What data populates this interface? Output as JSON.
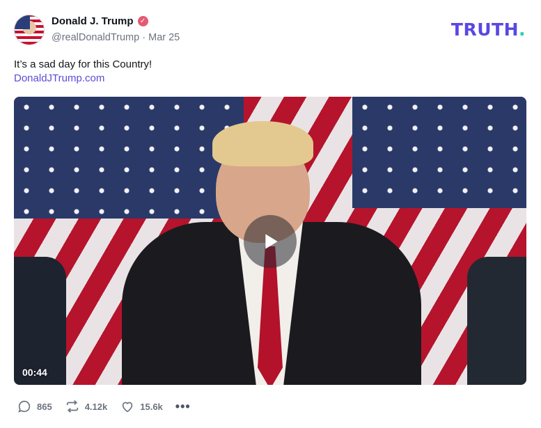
{
  "author": {
    "name": "Donald J. Trump",
    "verified_icon": "verified-badge-icon",
    "handle": "@realDonaldTrump",
    "separator": "·",
    "date": "Mar 25"
  },
  "brand": {
    "logo_text": "TRUTH",
    "logo_dot": ".",
    "accent": "#5a48e2",
    "dot_color": "#1dd3a0"
  },
  "post": {
    "text": "It’s a sad day for this Country!",
    "link": "DonaldJTrump.com"
  },
  "video": {
    "duration": "00:44",
    "play_icon": "play-icon"
  },
  "actions": {
    "replies": "865",
    "retruths": "4.12k",
    "likes": "15.6k",
    "more": "•••"
  }
}
